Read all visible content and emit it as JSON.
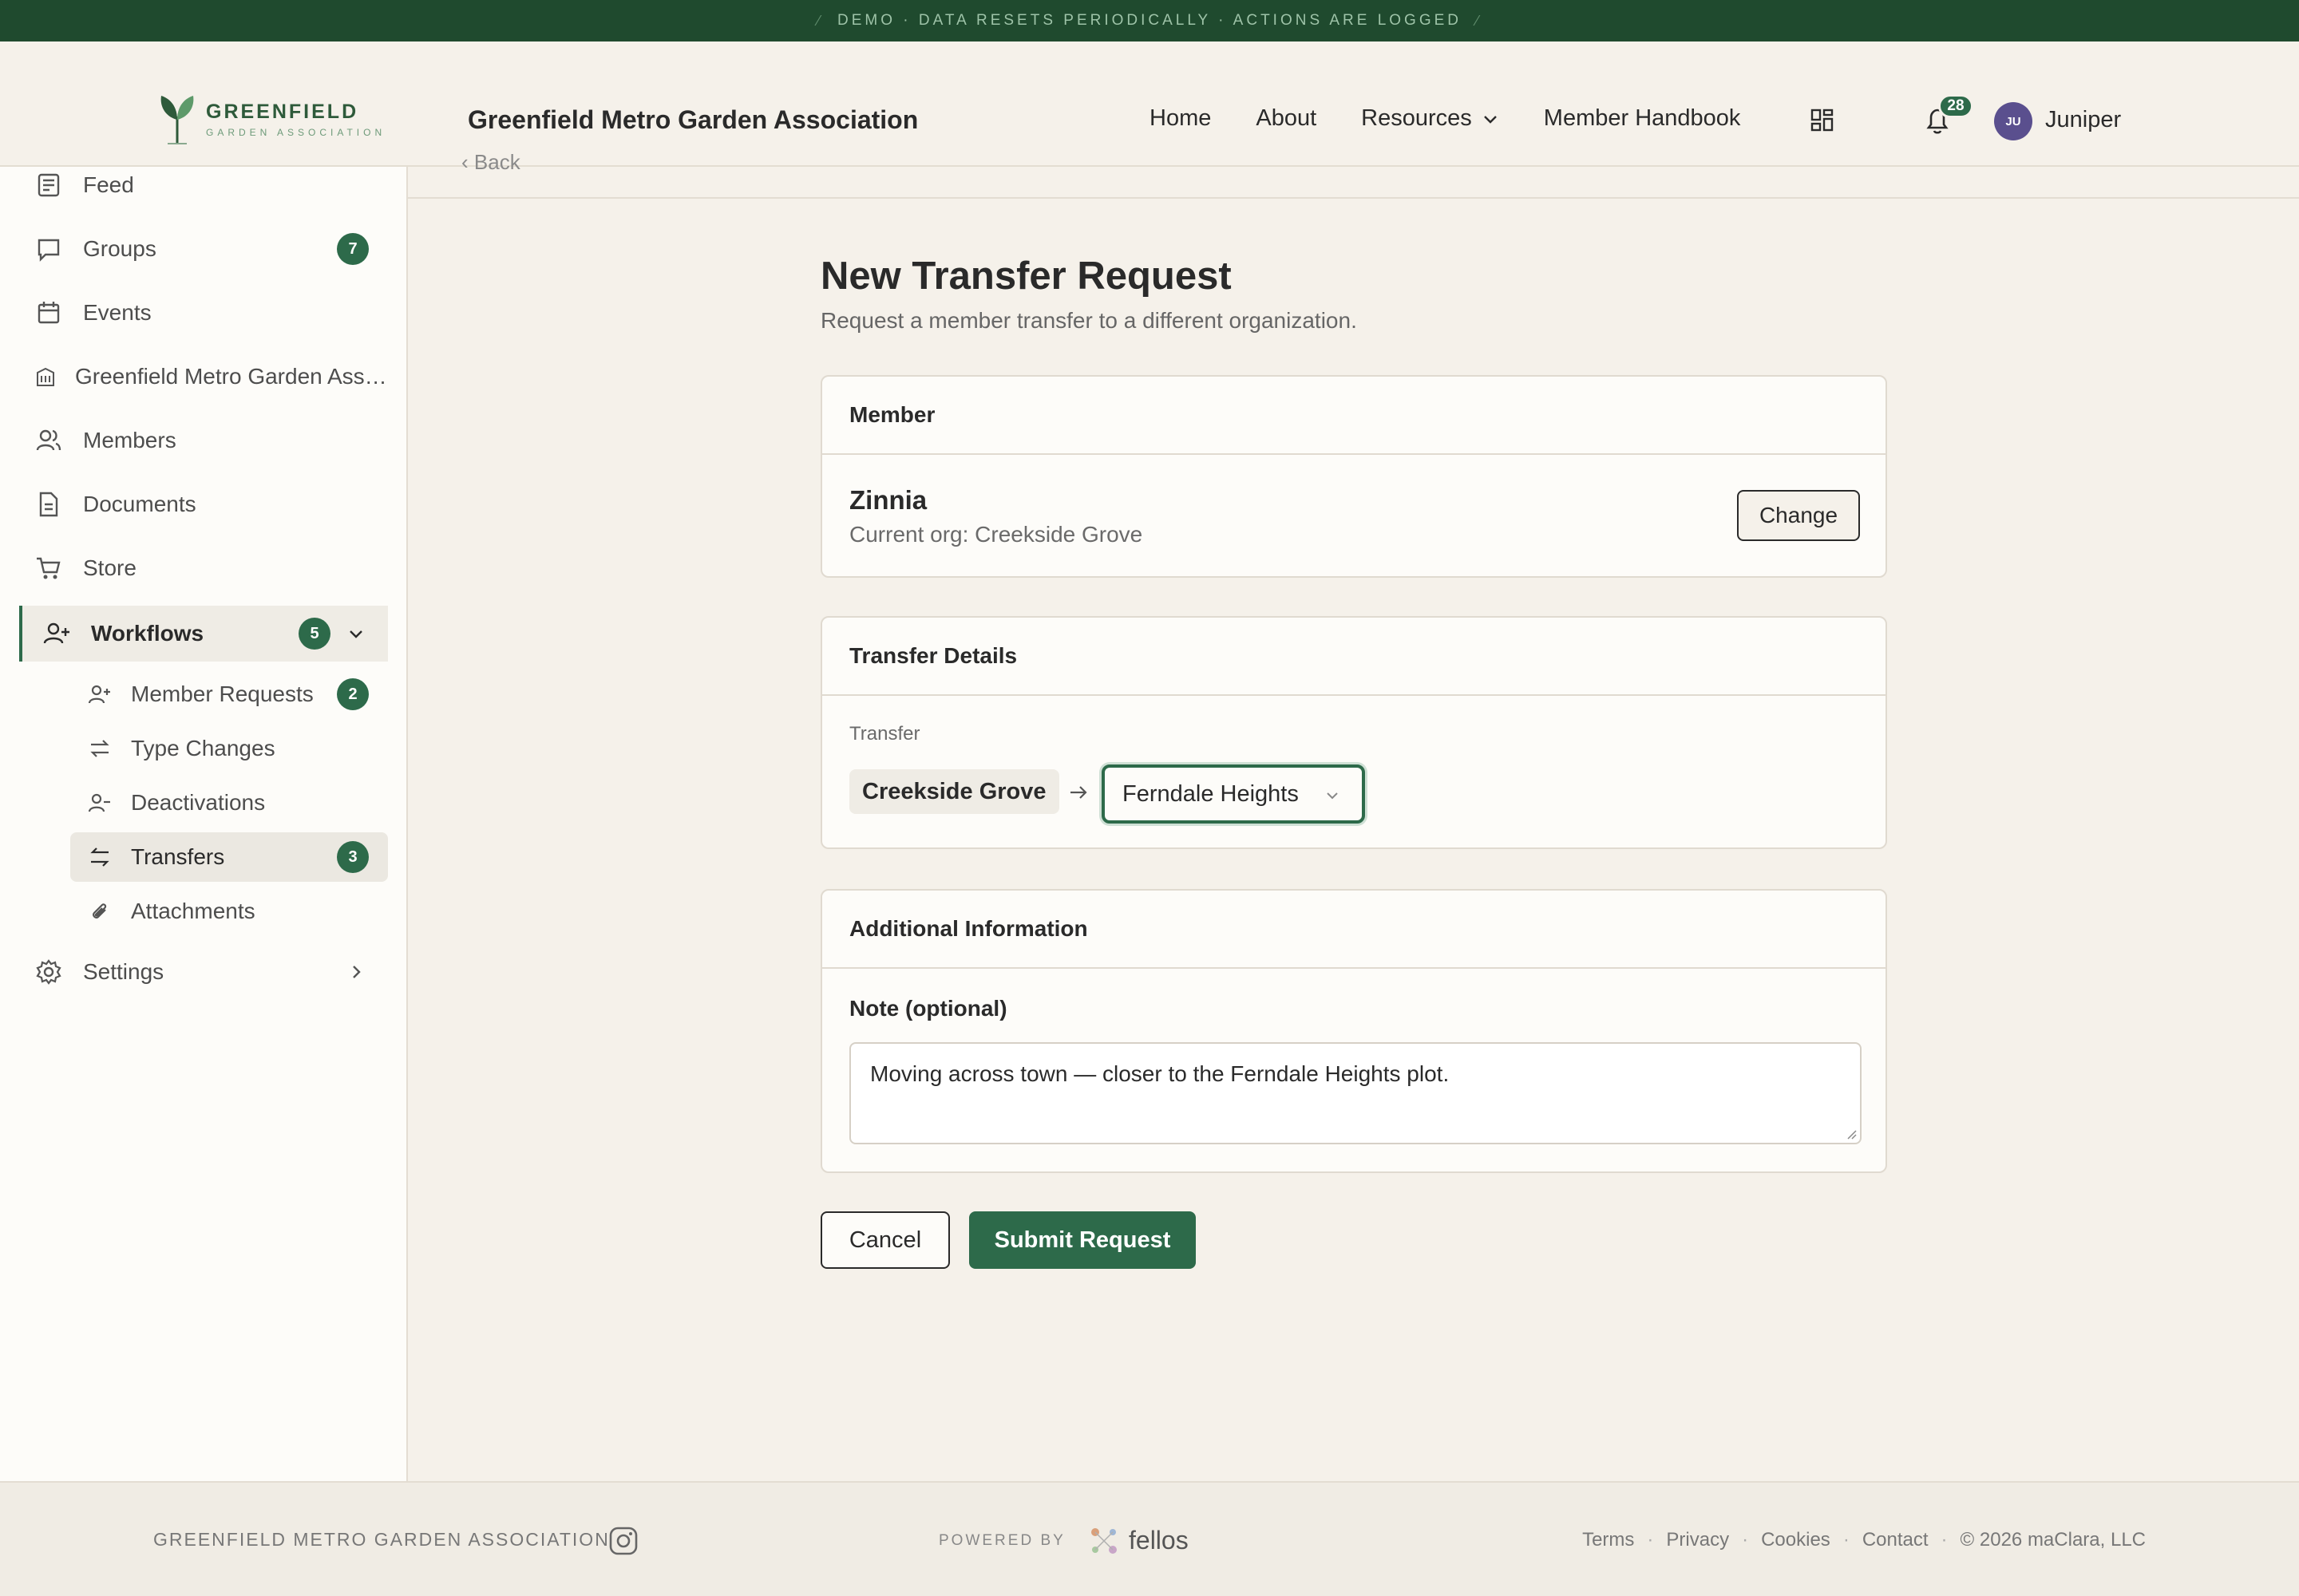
{
  "banner": {
    "text": "DEMO · DATA RESETS PERIODICALLY · ACTIONS ARE LOGGED"
  },
  "header": {
    "logo_name": "GREENFIELD",
    "logo_sub": "GARDEN ASSOCIATION",
    "org_title": "Greenfield Metro Garden Association",
    "nav": {
      "home": "Home",
      "about": "About",
      "resources": "Resources",
      "handbook": "Member Handbook"
    },
    "notification_count": "28",
    "avatar_initials": "JU",
    "user_name": "Juniper"
  },
  "sidebar": {
    "items": [
      {
        "label": "Feed",
        "icon": "feed-icon"
      },
      {
        "label": "Groups",
        "icon": "chat-icon",
        "badge": "7"
      },
      {
        "label": "Events",
        "icon": "calendar-icon"
      },
      {
        "label": "Greenfield Metro Garden Association",
        "icon": "building-icon"
      },
      {
        "label": "Members",
        "icon": "users-icon"
      },
      {
        "label": "Documents",
        "icon": "document-icon"
      },
      {
        "label": "Store",
        "icon": "cart-icon"
      },
      {
        "label": "Workflows",
        "icon": "user-plus-icon",
        "badge": "5"
      },
      {
        "label": "Settings",
        "icon": "gear-icon"
      }
    ],
    "workflow_items": [
      {
        "label": "Member Requests",
        "badge": "2"
      },
      {
        "label": "Type Changes"
      },
      {
        "label": "Deactivations"
      },
      {
        "label": "Transfers",
        "badge": "3"
      },
      {
        "label": "Attachments"
      }
    ]
  },
  "main": {
    "back": "Back",
    "title": "New Transfer Request",
    "subtitle": "Request a member transfer to a different organization.",
    "member_card": {
      "heading": "Member",
      "name": "Zinnia",
      "current_org": "Current org: Creekside Grove",
      "change_label": "Change"
    },
    "transfer_card": {
      "heading": "Transfer Details",
      "label": "Transfer",
      "from": "Creekside Grove",
      "to": "Ferndale Heights"
    },
    "info_card": {
      "heading": "Additional Information",
      "note_label": "Note (optional)",
      "note_value": "Moving across town — closer to the Ferndale Heights plot."
    },
    "cancel_label": "Cancel",
    "submit_label": "Submit Request"
  },
  "footer": {
    "org": "GREENFIELD METRO GARDEN ASSOCIATION",
    "powered_by": "POWERED BY",
    "brand": "fellos",
    "links": {
      "terms": "Terms",
      "privacy": "Privacy",
      "cookies": "Cookies",
      "contact": "Contact"
    },
    "copyright": "© 2026 maClara, LLC"
  },
  "colors": {
    "accent": "#2d6a4a",
    "banner": "#1f4a2e",
    "background": "#f5f1ea"
  }
}
